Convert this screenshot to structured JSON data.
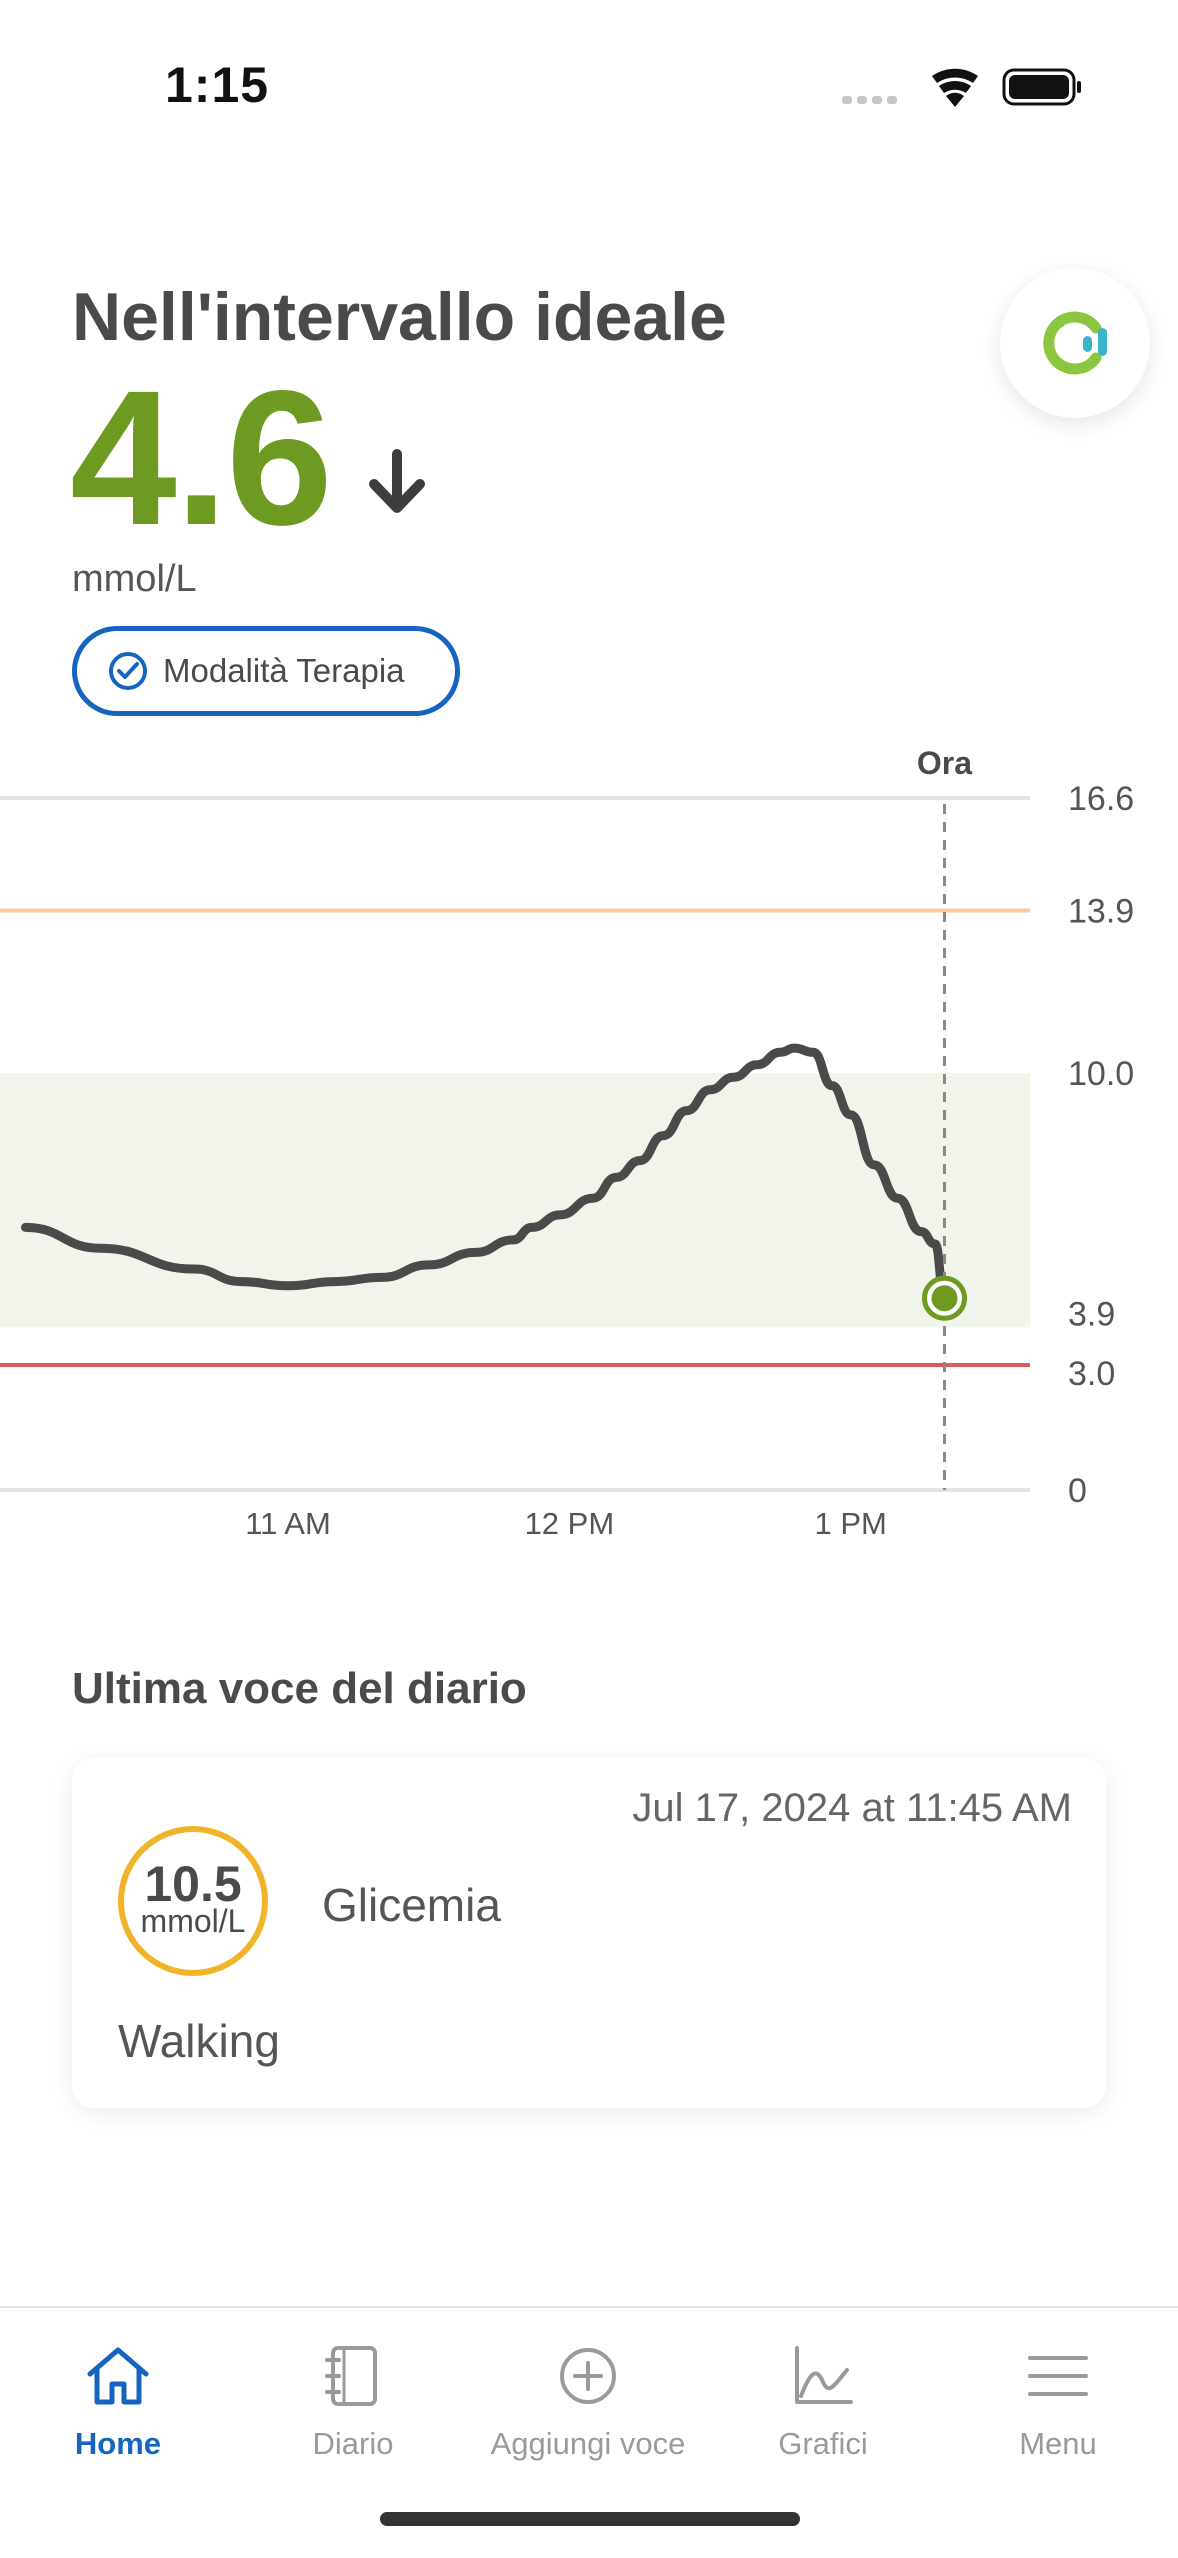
{
  "status_bar": {
    "time": "1:15"
  },
  "header": {
    "title": "Nell'intervallo ideale",
    "reading": "4.6",
    "unit": "mmol/L",
    "trend_icon": "arrow-down-icon",
    "mode_label": "Modalità Terapia"
  },
  "colors": {
    "in_range": "#6f9a22",
    "accent": "#1565c0",
    "high_line": "#f6c99a",
    "low_line": "#d95c5c",
    "target_band": "#f1f4ea",
    "entry_ring": "#f0b429",
    "curve": "#4a4a4a"
  },
  "chart_data": {
    "type": "line",
    "now_label": "Ora",
    "y_ticks": [
      "16.6",
      "13.9",
      "10.0",
      "3.9",
      "3.0",
      "0"
    ],
    "x_ticks": [
      "11 AM",
      "12 PM",
      "1 PM"
    ],
    "ylim": [
      0,
      16.6
    ],
    "target_range": [
      3.9,
      10.0
    ],
    "high_threshold": 13.9,
    "low_threshold": 3.0,
    "series": [
      {
        "x": [
          "10:04",
          "10:20",
          "10:40",
          "10:50",
          "11:00",
          "11:10",
          "11:20",
          "11:30",
          "11:40",
          "11:48",
          "11:52",
          "11:58",
          "12:05",
          "12:10",
          "12:15",
          "12:20",
          "12:25",
          "12:30",
          "12:35",
          "12:40",
          "12:45",
          "12:48",
          "12:52",
          "12:56",
          "13:00",
          "13:05",
          "13:10",
          "13:15",
          "13:18",
          "13:20"
        ],
        "values": [
          6.3,
          5.8,
          5.3,
          5.0,
          4.9,
          5.0,
          5.1,
          5.4,
          5.7,
          6.0,
          6.3,
          6.6,
          7.0,
          7.5,
          7.9,
          8.5,
          9.1,
          9.6,
          9.9,
          10.2,
          10.5,
          10.6,
          10.5,
          9.7,
          9.0,
          7.8,
          7.0,
          6.2,
          5.9,
          4.6
        ]
      }
    ]
  },
  "diary": {
    "section_title": "Ultima voce del diario",
    "date": "Jul 17, 2024 at 11:45 AM",
    "value": "10.5",
    "unit": "mmol/L",
    "type": "Glicemia",
    "note": "Walking"
  },
  "nav": {
    "items": [
      {
        "label": "Home",
        "icon": "home-icon"
      },
      {
        "label": "Diario",
        "icon": "notebook-icon"
      },
      {
        "label": "Aggiungi voce",
        "icon": "plus-circle-icon"
      },
      {
        "label": "Grafici",
        "icon": "line-chart-icon"
      },
      {
        "label": "Menu",
        "icon": "hamburger-menu-icon"
      }
    ]
  }
}
